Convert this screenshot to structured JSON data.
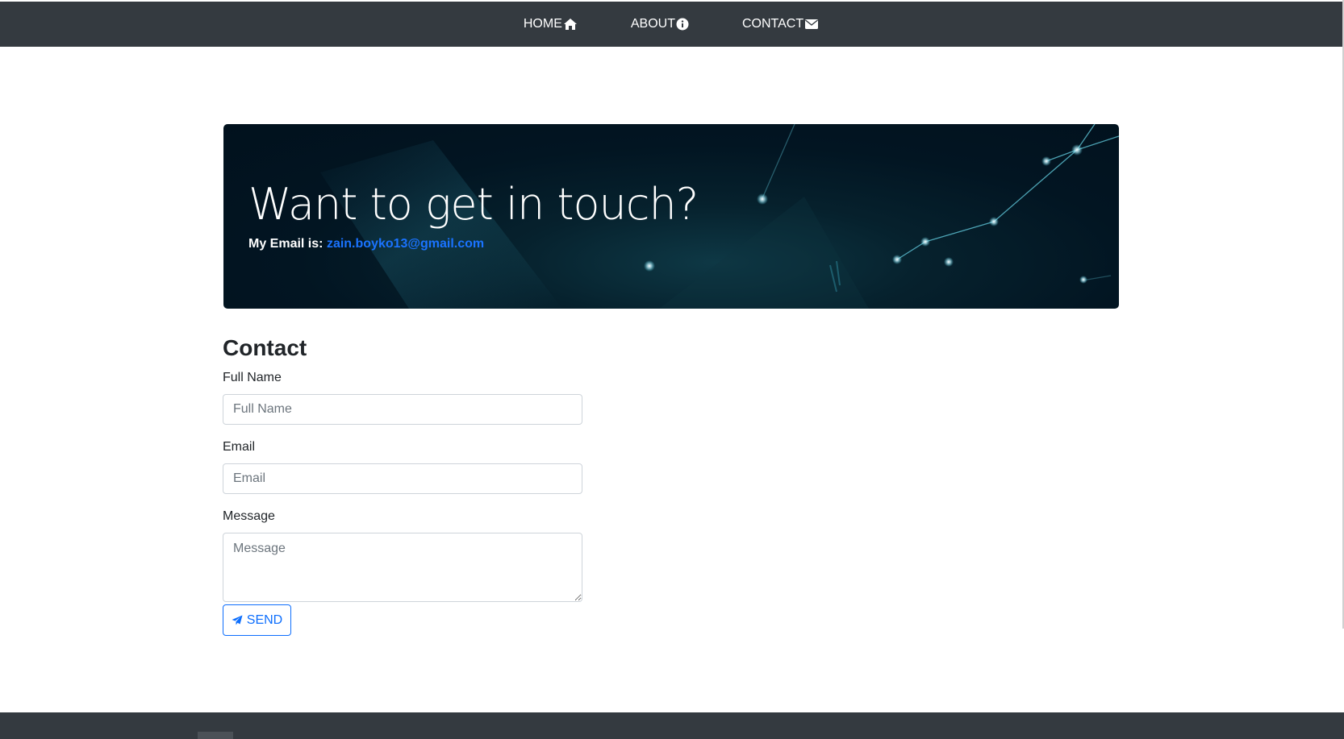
{
  "nav": {
    "items": [
      {
        "label": "HOME",
        "icon": "home-icon"
      },
      {
        "label": "ABOUT",
        "icon": "info-icon"
      },
      {
        "label": "CONTACT",
        "icon": "envelope-icon"
      }
    ]
  },
  "hero": {
    "title": "Want to get in touch?",
    "email_prefix": "My Email is:",
    "email": "zain.boyko13@gmail.com"
  },
  "contact": {
    "title": "Contact",
    "full_name_label": "Full Name",
    "full_name_placeholder": "Full Name",
    "email_label": "Email",
    "email_placeholder": "Email",
    "message_label": "Message",
    "message_placeholder": "Message",
    "send_label": "SEND",
    "send_icon": "paper-plane-icon"
  },
  "colors": {
    "navbar": "#343a40",
    "link": "#1a73ff",
    "primary": "#0d6efd"
  }
}
